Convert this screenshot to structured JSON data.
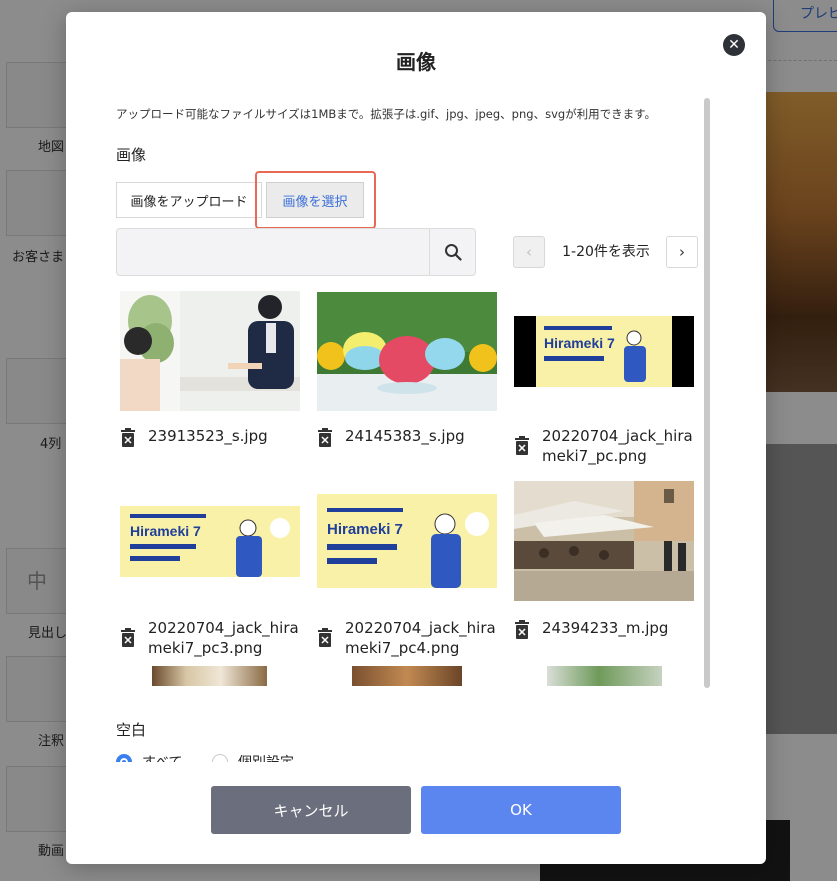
{
  "background": {
    "preview_button": "プレビ",
    "sidebar_labels": [
      "地図",
      "お客さま",
      "4列",
      "見出し",
      "注釈",
      "動画"
    ],
    "heading_tile_char": "中"
  },
  "modal": {
    "title": "画像",
    "note": "アップロード可能なファイルサイズは1MBまで。拡張子は.gif、jpg、jpeg、png、svgが利用できます。",
    "image_section_label": "画像",
    "tabs": {
      "upload": "画像をアップロード",
      "select": "画像を選択"
    },
    "search": {
      "placeholder": "",
      "value": ""
    },
    "pagination": {
      "label": "1-20件を表示",
      "prev": "‹",
      "next": "›"
    },
    "images": [
      {
        "file": "23913523_s.jpg",
        "kind": "office-photo"
      },
      {
        "file": "24145383_s.jpg",
        "kind": "shaved-ice-photo"
      },
      {
        "file": "20220704_jack_hiraméki7_pc.png",
        "kind": "hirameki-banner"
      },
      {
        "file": "20220704_jack_hirameki7_pc3.png",
        "kind": "hirameki-banner"
      },
      {
        "file": "20220704_jack_hirameki7_pc4.png",
        "kind": "hirameki-banner"
      },
      {
        "file": "24394233_m.jpg",
        "kind": "cafe-street-photo"
      }
    ],
    "margin_section_label": "空白",
    "margin_options": {
      "all": "すべて",
      "individual": "個別設定"
    },
    "buttons": {
      "cancel": "キャンセル",
      "ok": "OK"
    },
    "banner_text": "Hirameki 7"
  },
  "colors": {
    "accent": "#3a6fd8",
    "ok": "#5b86f0",
    "cancel": "#6b6f7d",
    "highlight": "#e86a55"
  }
}
